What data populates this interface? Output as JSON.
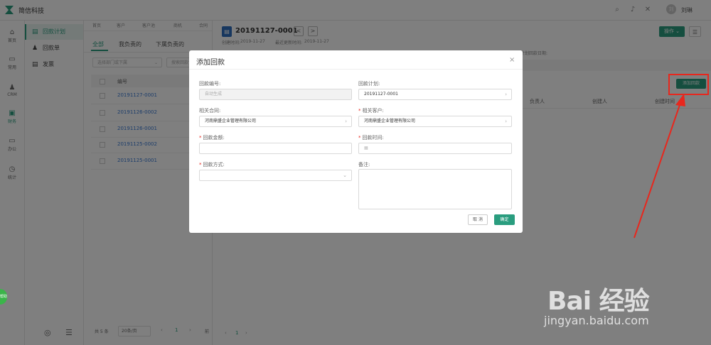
{
  "app": {
    "brand": "简信科技",
    "user": "刘琳",
    "avatar_text": "刘"
  },
  "left_nav": [
    {
      "icon": "⌂",
      "label": "首页"
    },
    {
      "icon": "▭",
      "label": "常用"
    },
    {
      "icon": "♟",
      "label": "CRM"
    },
    {
      "icon": "▣",
      "label": "财务"
    },
    {
      "icon": "▭",
      "label": "办公"
    },
    {
      "icon": "◷",
      "label": "统计"
    }
  ],
  "sub_nav": [
    {
      "icon": "▤",
      "label": "回款计划"
    },
    {
      "icon": "♟",
      "label": "回款单"
    },
    {
      "icon": "▤",
      "label": "发票"
    }
  ],
  "crumbs": [
    "首页",
    "客户",
    "客户池",
    "商机",
    "合同"
  ],
  "list": {
    "tabs": [
      "全部",
      "我负责的",
      "下属负责的"
    ],
    "filter_dept": "选择部门或下属",
    "filter_search": "搜索回款计",
    "column": "编号",
    "rows": [
      "20191127-0001",
      "20191126-0002",
      "20191126-0001",
      "20191125-0002",
      "20191125-0001"
    ],
    "pager_total": "共 5 条",
    "pager_size": "20条/页",
    "page": "1",
    "goto": "前"
  },
  "detail": {
    "title": "20191127-0001",
    "prev": "<",
    "next": ">",
    "created_label": "创建时间:",
    "created": "2019-11-27",
    "updated_label": "最近更新时间:",
    "updated": "2019-11-27",
    "ops_button": "操作",
    "more_icon": "☰",
    "add_payment_button": "添加回款",
    "plan_date_label": "计划回款日期:",
    "table_headers": [
      "负责人",
      "创建人",
      "创建时间"
    ],
    "pager_page": "1"
  },
  "modal": {
    "title": "添加回款",
    "close": "×",
    "fields": {
      "payment_no": {
        "label": "回款编号:",
        "placeholder": "自动生成"
      },
      "payment_plan": {
        "label": "回款计划:",
        "value": "20191127-0001"
      },
      "contract": {
        "label": "相关合同:",
        "value": "河南鼎盛企业管理有限公司"
      },
      "customer": {
        "label": "相关客户:",
        "value": "河南鼎盛企业管理有限公司"
      },
      "amount": {
        "label": "回款金额:",
        "value": ""
      },
      "time": {
        "label": "回款时间:",
        "value": ""
      },
      "method": {
        "label": "回款方式:",
        "value": ""
      },
      "remark": {
        "label": "备注:",
        "value": ""
      }
    },
    "cancel": "取 消",
    "confirm": "确定"
  },
  "watermark": {
    "main": "Bai 经验",
    "url": "jingyan.baidu.com"
  },
  "help_badge": "帮助",
  "colors": {
    "accent": "#2a9d7f",
    "highlight": "#e8271d",
    "link": "#3a7bd5"
  }
}
